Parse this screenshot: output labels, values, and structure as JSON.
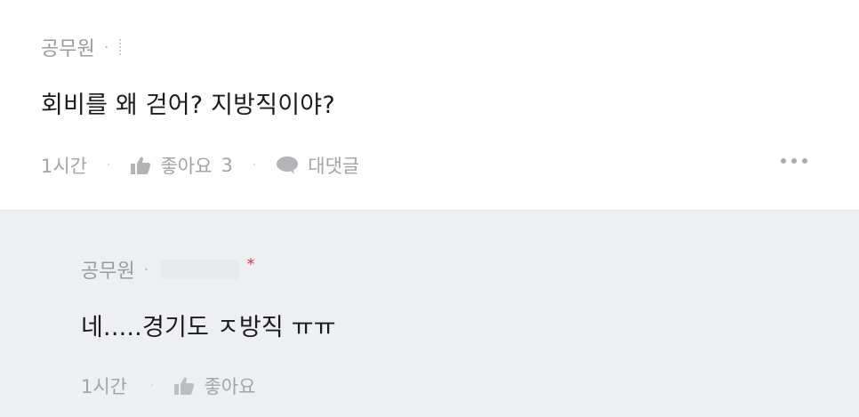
{
  "comment": {
    "author": "공무원",
    "body": "회비를 왜 걷어? 지방직이야?",
    "time": "1시간",
    "like_label": "좋아요",
    "like_count": "3",
    "reply_label": "대댓글"
  },
  "reply": {
    "author": "공무원",
    "badge": "*",
    "body": "네.....경기도 ㅈ방직 ㅠㅠ",
    "time": "1시간",
    "like_label": "좋아요"
  },
  "separators": {
    "dot": "·"
  },
  "icons": {
    "like": "thumbs-up-icon",
    "reply": "speech-bubble-icon",
    "more": "more-dots-icon"
  },
  "colors": {
    "reply_background": "#eeeff3",
    "badge": "#d93a3a",
    "meta_text": "#a3a4a9"
  }
}
